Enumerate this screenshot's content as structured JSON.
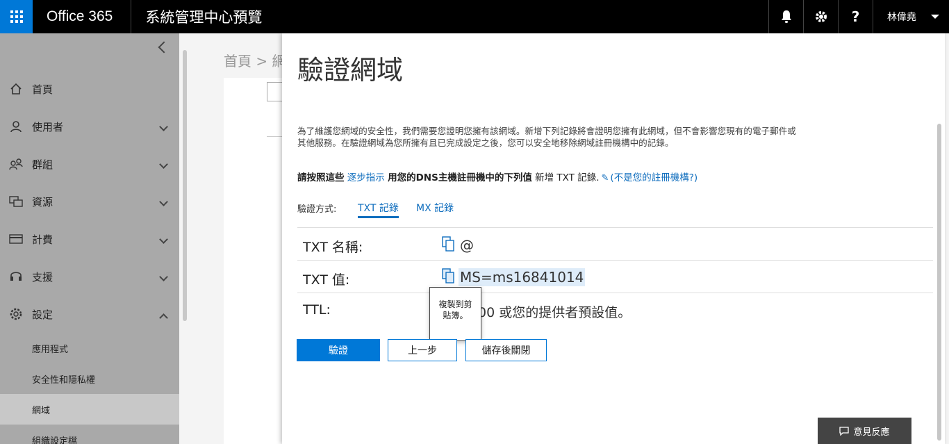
{
  "topbar": {
    "brand": "Office 365",
    "app_title": "系統管理中心預覽",
    "help_label": "?",
    "user_name": "林偉堯"
  },
  "nav": {
    "items": [
      {
        "label": "首頁",
        "icon": "home-icon"
      },
      {
        "label": "使用者",
        "icon": "user-icon"
      },
      {
        "label": "群組",
        "icon": "groups-icon"
      },
      {
        "label": "資源",
        "icon": "resources-icon"
      },
      {
        "label": "計費",
        "icon": "billing-icon"
      },
      {
        "label": "支援",
        "icon": "headset-icon"
      },
      {
        "label": "設定",
        "icon": "gear-icon"
      }
    ],
    "settings_sub": [
      "應用程式",
      "安全性和隱私權",
      "網域",
      "組織設定檔"
    ],
    "active_sub": "網域"
  },
  "background": {
    "breadcrumb": "首頁 > 網"
  },
  "panel": {
    "title": "驗證網域",
    "description": "為了維護您網域的安全性，我們需要您證明您擁有該網域。新增下列記錄將會證明您擁有此網域，但不會影響您現有的電子郵件或其他服務。在驗證網域為您所擁有且已完成設定之後，您可以安全地移除網域註冊機構中的記錄。",
    "instruction": {
      "part1": "請按照這些",
      "link": "逐步指示",
      "part2": "用您的DNS主機註冊機中的下列值",
      "part3": "新增 TXT 記錄.",
      "registrar_link": "(不是您的註冊機構?)"
    },
    "method_label": "驗證方式:",
    "tabs": [
      {
        "label": "TXT 記錄",
        "active": true
      },
      {
        "label": "MX 記錄",
        "active": false
      }
    ],
    "rows": [
      {
        "label": "TXT 名稱:",
        "value": "@"
      },
      {
        "label": "TXT 值:",
        "value": "MS=ms16841014"
      },
      {
        "label": "TTL:",
        "value": "00 或您的提供者預設值。"
      }
    ],
    "tooltip": "複製到剪貼簿。",
    "buttons": {
      "verify": "驗證",
      "back": "上一步",
      "save_close": "儲存後關閉"
    }
  },
  "feedback": {
    "label": "意見反應"
  },
  "colors": {
    "accent": "#0078d7",
    "link": "#106ebe",
    "nav_bg": "#a9a9a9"
  }
}
